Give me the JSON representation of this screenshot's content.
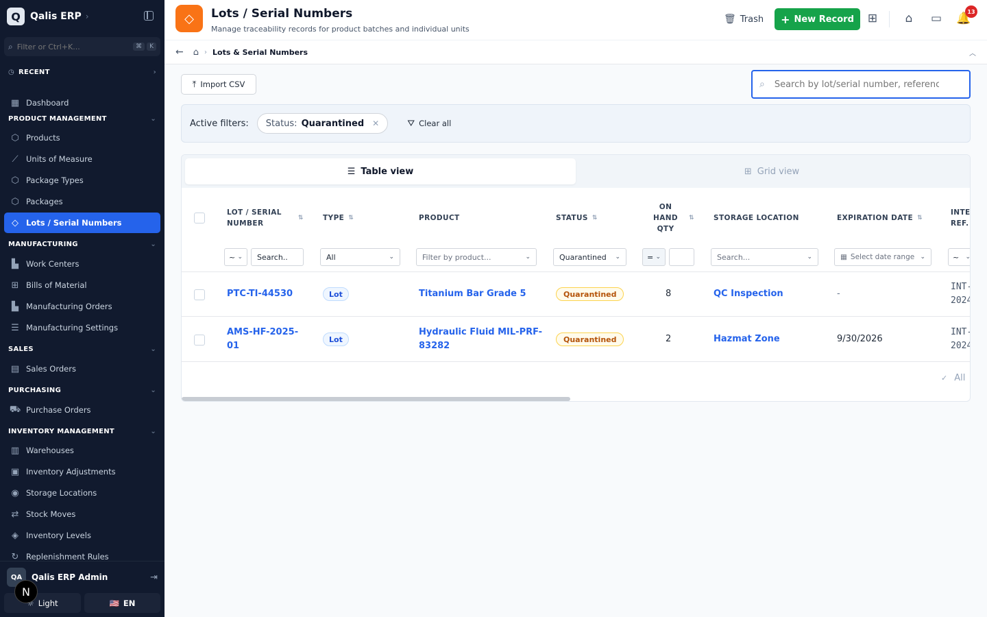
{
  "app": {
    "logo": "Q",
    "name": "Qalis ERP"
  },
  "sidebar": {
    "filter_placeholder": "Filter or Ctrl+K...",
    "kbd": [
      "⌘",
      "K"
    ],
    "recent_label": "RECENT",
    "dashboard_label": "Dashboard",
    "sections": {
      "product": "PRODUCT MANAGEMENT",
      "manufacturing": "MANUFACTURING",
      "sales": "SALES",
      "purchasing": "PURCHASING",
      "inventory": "INVENTORY MANAGEMENT"
    },
    "items": {
      "products": "Products",
      "uom": "Units of Measure",
      "package_types": "Package Types",
      "packages": "Packages",
      "lots": "Lots / Serial Numbers",
      "work_centers": "Work Centers",
      "bom": "Bills of Material",
      "mo": "Manufacturing Orders",
      "mfg_settings": "Manufacturing Settings",
      "sales_orders": "Sales Orders",
      "purchase_orders": "Purchase Orders",
      "warehouses": "Warehouses",
      "inv_adjust": "Inventory Adjustments",
      "storage_locations": "Storage Locations",
      "stock_moves": "Stock Moves",
      "inv_levels": "Inventory Levels",
      "replenishment": "Replenishment Rules"
    },
    "user": {
      "initials": "QA",
      "name": "Qalis ERP Admin"
    },
    "n_badge": "N",
    "theme_label": "Light",
    "lang_flag": "🇺🇸",
    "lang_label": "EN"
  },
  "header": {
    "title": "Lots / Serial Numbers",
    "subtitle": "Manage traceability records for product batches and individual units",
    "trash_label": "Trash",
    "new_record_label": "New Record",
    "notification_count": "13"
  },
  "breadcrumb": {
    "current": "Lots & Serial Numbers"
  },
  "toolbar": {
    "import_label": "Import CSV",
    "search_placeholder": "Search by lot/serial number, reference, product..."
  },
  "filters": {
    "label": "Active filters:",
    "chip_key": "Status:",
    "chip_value": "Quarantined",
    "clear_label": "Clear all"
  },
  "views": {
    "table": "Table view",
    "grid": "Grid view"
  },
  "table": {
    "headers": {
      "lot": [
        "LOT / SERIAL",
        "NUMBER"
      ],
      "type": "TYPE",
      "product": "PRODUCT",
      "status": "STATUS",
      "qty": [
        "ON",
        "HAND",
        "QTY"
      ],
      "location": "STORAGE LOCATION",
      "expiration": "EXPIRATION DATE",
      "ref": [
        "INTE",
        "REF."
      ]
    },
    "filter_row": {
      "lot_op": "~",
      "lot_search": "Search..",
      "type": "All",
      "product": "Filter by product...",
      "status": "Quarantined",
      "qty_op": "=",
      "location": "Search...",
      "expiration": "Select date range",
      "ref_op": "~"
    },
    "rows": [
      {
        "lot": [
          "PTC-TI-44530"
        ],
        "type": "Lot",
        "product": [
          "Titanium Bar Grade 5"
        ],
        "status": "Quarantined",
        "qty": "8",
        "location": "QC Inspection",
        "expiration": "-",
        "ref": [
          "INT-",
          "2024"
        ]
      },
      {
        "lot": [
          "AMS-HF-2025-",
          "01"
        ],
        "type": "Lot",
        "product": [
          "Hydraulic Fluid MIL-PRF-",
          "83282"
        ],
        "status": "Quarantined",
        "qty": "2",
        "location": "Hazmat Zone",
        "expiration": "9/30/2026",
        "ref": [
          "INT-",
          "2024"
        ]
      }
    ],
    "footer_all": "All"
  },
  "colors": {
    "accent": "#2563eb",
    "sidebar_bg": "#111a2e",
    "success": "#16a34a",
    "brand_orange": "#f97316"
  }
}
